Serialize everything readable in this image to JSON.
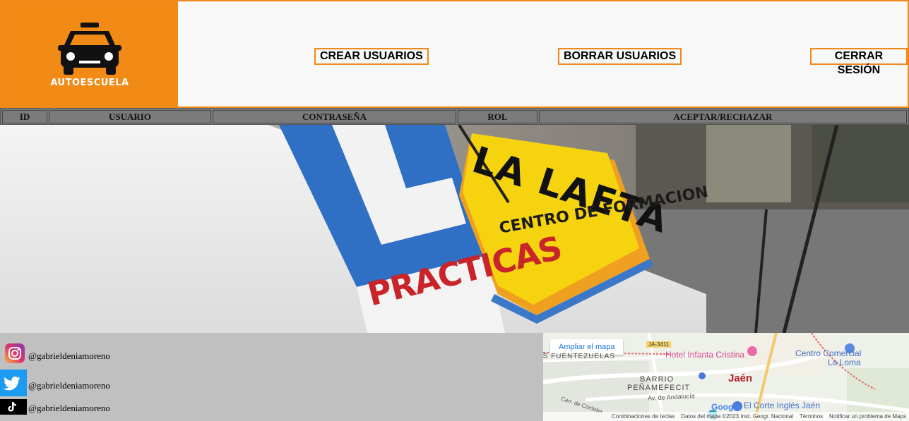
{
  "header": {
    "logo_text": "AUTOESCUELA",
    "nav": {
      "create_users": "CREAR USUARIOS",
      "delete_users": "BORRAR USUARIOS",
      "logout": "CERRAR SESIÓN"
    }
  },
  "table": {
    "columns": [
      "ID",
      "USUARIO",
      "CONTRASEÑA",
      "ROL",
      "ACEPTAR/RECHAZAR"
    ]
  },
  "hero": {
    "sign_l": "L",
    "sign_practicas": "PRACTICAS",
    "sign_name": "LA LAETA",
    "sign_sub": "CENTRO DE FORMACION"
  },
  "footer": {
    "social": [
      {
        "icon": "instagram-icon",
        "handle": "@gabrieldeniamoreno"
      },
      {
        "icon": "twitter-icon",
        "handle": "@gabrieldeniamoreno"
      },
      {
        "icon": "tiktok-icon",
        "handle": "@gabrieldeniamoreno"
      }
    ],
    "map": {
      "enlarge": "Ampliar el mapa",
      "road_badge": "JA-3411",
      "labels": {
        "fuentezuelas": "AS FUENTEZUELAS",
        "hotel": "Hotel Infanta Cristina",
        "centro": "Centro Comercial",
        "centro2": "La Loma",
        "barrio": "BARRIO",
        "barrio2": "PEÑAMEFECIT",
        "city": "Jaén",
        "avenue": "Av. de Andalucía",
        "road": "Carr. de Córdoba",
        "corte": "El Corte Inglés Jaén",
        "google": "Google"
      },
      "footer": {
        "shortcuts": "Combinaciones de teclas",
        "data": "Datos del mapa ©2023 Inst. Geogr. Nacional",
        "terms": "Términos",
        "report": "Notificar un problema de Maps"
      }
    }
  },
  "colors": {
    "accent": "#f28a16",
    "header_bg": "#f8f8f8",
    "table_header_bg": "#7b7b7b",
    "footer_bg": "#c0c0c0"
  }
}
